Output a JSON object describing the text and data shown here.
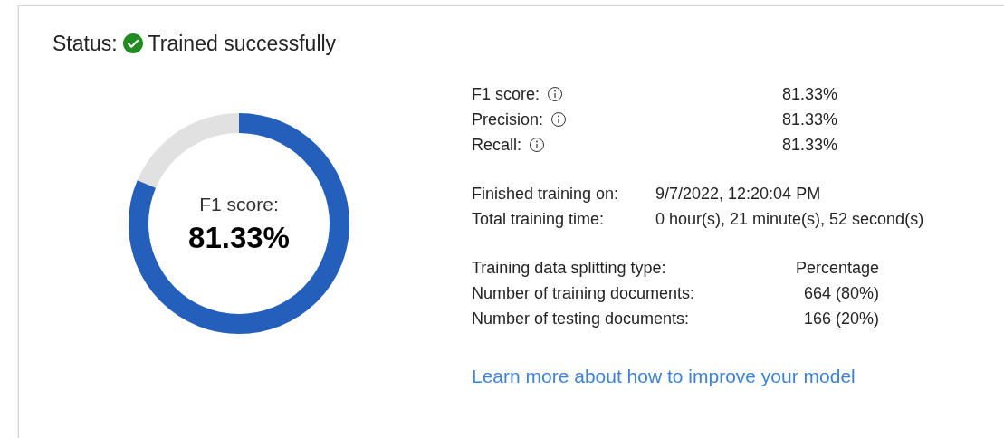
{
  "status": {
    "label": "Status:",
    "value": "Trained successfully"
  },
  "score_ring": {
    "label": "F1 score:",
    "value": "81.33%",
    "level": 0.8133
  },
  "metrics": [
    {
      "label": "F1 score:",
      "value": "81.33%"
    },
    {
      "label": "Precision:",
      "value": "81.33%"
    },
    {
      "label": "Recall:",
      "value": "81.33%"
    }
  ],
  "training": [
    {
      "label": "Finished training on:",
      "value": "9/7/2022, 12:20:04 PM"
    },
    {
      "label": "Total training time:",
      "value": "0 hour(s), 21 minute(s), 52 second(s)"
    }
  ],
  "data_split": [
    {
      "label": "Training data splitting type:",
      "value": "Percentage"
    },
    {
      "label": "Number of training documents:",
      "value": "664 (80%)"
    },
    {
      "label": "Number of testing documents:",
      "value": "166 (20%)"
    }
  ],
  "link": "Learn more about how to improve your model"
}
